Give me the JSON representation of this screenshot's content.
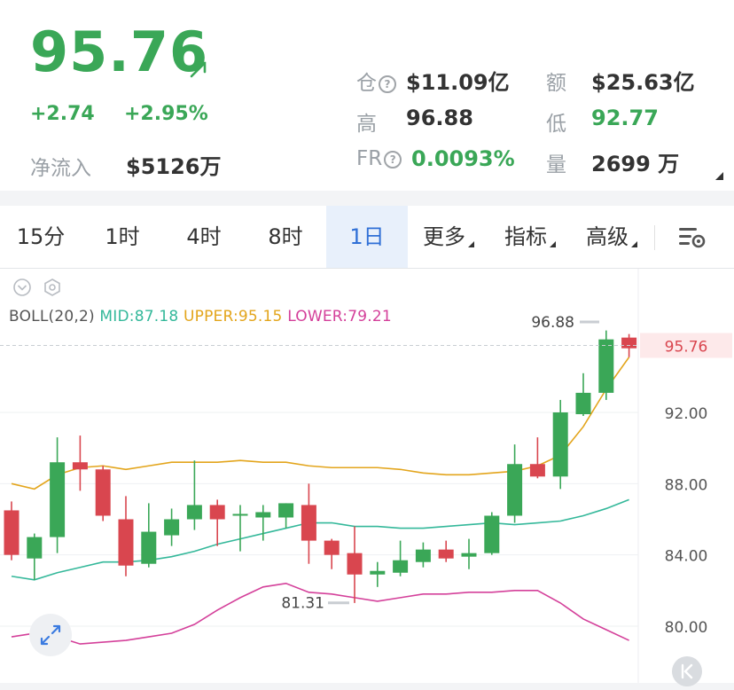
{
  "quote": {
    "price": "95.76",
    "change": "+2.74",
    "change_pct": "+2.95%",
    "net_inflow_label": "净流入",
    "net_inflow_value": "$5126万",
    "oi_label": "仓",
    "oi_value": "$11.09亿",
    "turnover_label": "额",
    "turnover_value": "$25.63亿",
    "high_label": "高",
    "high_value": "96.88",
    "low_label": "低",
    "low_value": "92.77",
    "fr_label": "FR",
    "fr_value": "0.0093%",
    "volume_label": "量",
    "volume_value": "2699 万",
    "up_color": "#3aa757",
    "down_color": "#d9464f"
  },
  "tabs": [
    {
      "label": "15分"
    },
    {
      "label": "1时"
    },
    {
      "label": "4时"
    },
    {
      "label": "8时"
    },
    {
      "label": "1日",
      "active": true
    },
    {
      "label": "更多"
    },
    {
      "label": "指标"
    },
    {
      "label": "高级"
    }
  ],
  "icons": {
    "settings": "chart-settings-icon",
    "collapse": "chevron-down-circle-icon",
    "hexagon": "hexagon-settings-icon",
    "expand": "expand-icon",
    "back": "back-to-latest-icon",
    "arrow": "arrow-up-right-icon"
  },
  "chart_data": {
    "type": "candlestick",
    "indicator_text": {
      "name": "BOLL(20,2)",
      "mid": "MID:87.18",
      "upper": "UPPER:95.15",
      "lower": "LOWER:79.21"
    },
    "y_ticks": [
      "92.00",
      "88.00",
      "84.00",
      "80.00"
    ],
    "y_range": [
      79.0,
      97.5
    ],
    "current_price_label": "95.76",
    "high_marker": "96.88",
    "low_marker": "81.31",
    "candles": [
      {
        "o": 86.5,
        "h": 87.0,
        "l": 83.7,
        "c": 84.0
      },
      {
        "o": 83.8,
        "h": 85.2,
        "l": 82.6,
        "c": 85.0
      },
      {
        "o": 85.0,
        "h": 90.6,
        "l": 84.1,
        "c": 89.2
      },
      {
        "o": 89.2,
        "h": 90.7,
        "l": 87.6,
        "c": 88.8
      },
      {
        "o": 88.8,
        "h": 89.0,
        "l": 85.9,
        "c": 86.2
      },
      {
        "o": 86.0,
        "h": 87.3,
        "l": 82.8,
        "c": 83.4
      },
      {
        "o": 83.5,
        "h": 86.9,
        "l": 83.3,
        "c": 85.3
      },
      {
        "o": 85.1,
        "h": 86.6,
        "l": 84.5,
        "c": 86.0
      },
      {
        "o": 86.0,
        "h": 89.3,
        "l": 85.4,
        "c": 86.8
      },
      {
        "o": 86.8,
        "h": 87.1,
        "l": 84.5,
        "c": 86.0
      },
      {
        "o": 86.2,
        "h": 86.8,
        "l": 84.2,
        "c": 86.3
      },
      {
        "o": 86.1,
        "h": 86.8,
        "l": 84.8,
        "c": 86.4
      },
      {
        "o": 86.1,
        "h": 86.9,
        "l": 85.5,
        "c": 86.9
      },
      {
        "o": 86.8,
        "h": 88.0,
        "l": 83.5,
        "c": 84.8
      },
      {
        "o": 84.8,
        "h": 84.9,
        "l": 83.2,
        "c": 84.0
      },
      {
        "o": 84.1,
        "h": 85.6,
        "l": 81.3,
        "c": 82.9
      },
      {
        "o": 82.9,
        "h": 83.6,
        "l": 82.2,
        "c": 83.1
      },
      {
        "o": 83.0,
        "h": 84.8,
        "l": 82.8,
        "c": 83.7
      },
      {
        "o": 83.6,
        "h": 84.7,
        "l": 83.3,
        "c": 84.3
      },
      {
        "o": 84.3,
        "h": 84.8,
        "l": 83.6,
        "c": 83.8
      },
      {
        "o": 83.9,
        "h": 84.9,
        "l": 83.2,
        "c": 84.1
      },
      {
        "o": 84.1,
        "h": 86.4,
        "l": 84.0,
        "c": 86.2
      },
      {
        "o": 86.2,
        "h": 90.2,
        "l": 85.8,
        "c": 89.1
      },
      {
        "o": 89.1,
        "h": 90.6,
        "l": 88.3,
        "c": 88.4
      },
      {
        "o": 88.4,
        "h": 92.7,
        "l": 87.7,
        "c": 92.0
      },
      {
        "o": 91.9,
        "h": 94.2,
        "l": 91.8,
        "c": 93.1
      },
      {
        "o": 93.1,
        "h": 96.6,
        "l": 92.7,
        "c": 96.1
      },
      {
        "o": 96.2,
        "h": 96.4,
        "l": 95.1,
        "c": 95.6
      }
    ],
    "boll_mid": [
      82.8,
      82.6,
      83.0,
      83.3,
      83.6,
      83.6,
      83.7,
      83.9,
      84.2,
      84.6,
      84.9,
      85.2,
      85.5,
      85.8,
      85.8,
      85.6,
      85.6,
      85.5,
      85.5,
      85.6,
      85.7,
      85.8,
      85.7,
      85.8,
      85.9,
      86.2,
      86.6,
      87.1
    ],
    "boll_upper": [
      88.0,
      87.7,
      88.5,
      88.9,
      89.0,
      88.8,
      89.0,
      89.2,
      89.2,
      89.2,
      89.3,
      89.2,
      89.2,
      89.0,
      88.9,
      88.9,
      88.9,
      88.8,
      88.6,
      88.5,
      88.5,
      88.6,
      88.7,
      89.0,
      89.6,
      91.2,
      93.3,
      95.1
    ],
    "boll_lower": [
      79.4,
      79.6,
      79.4,
      79.0,
      79.1,
      79.2,
      79.4,
      79.6,
      80.1,
      80.9,
      81.6,
      82.2,
      82.4,
      81.9,
      81.8,
      81.6,
      81.4,
      81.6,
      81.8,
      81.8,
      81.9,
      81.9,
      82.0,
      82.0,
      81.3,
      80.4,
      79.8,
      79.2
    ]
  }
}
